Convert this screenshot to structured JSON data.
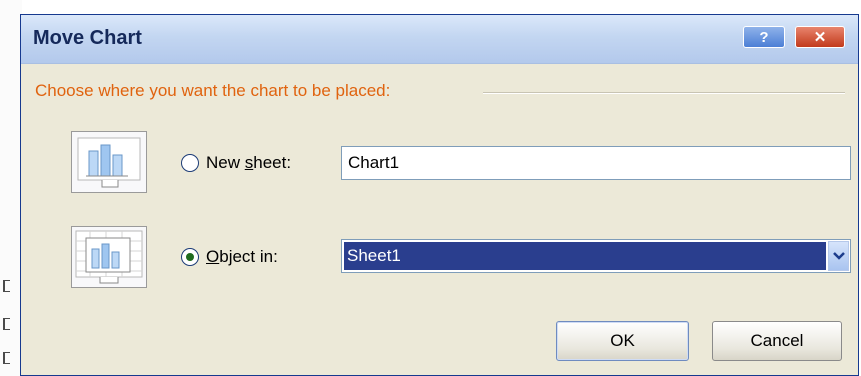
{
  "dialog": {
    "title": "Move Chart",
    "help_label": "?",
    "close_label": "✕",
    "instruction": "Choose where you want the chart to be placed:"
  },
  "options": {
    "new_sheet": {
      "label_pre": "New ",
      "label_accel": "s",
      "label_post": "heet:",
      "value": "Chart1",
      "selected": false,
      "icon": "new-sheet-chart-icon"
    },
    "object_in": {
      "label_pre": "",
      "label_accel": "O",
      "label_post": "bject in:",
      "value": "Sheet1",
      "selected": true,
      "icon": "embedded-chart-icon"
    }
  },
  "buttons": {
    "ok": "OK",
    "cancel": "Cancel"
  },
  "colors": {
    "accent": "#e0630f",
    "selection": "#2a3e8e",
    "dialog_bg": "#ece9d8"
  }
}
